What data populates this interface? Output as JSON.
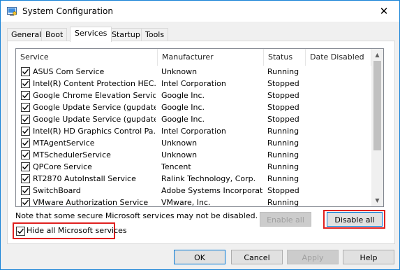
{
  "window": {
    "title": "System Configuration",
    "close_glyph": "✕"
  },
  "tabs": [
    {
      "label": "General"
    },
    {
      "label": "Boot"
    },
    {
      "label": "Services"
    },
    {
      "label": "Startup"
    },
    {
      "label": "Tools"
    }
  ],
  "services": {
    "columns": [
      "Service",
      "Manufacturer",
      "Status",
      "Date Disabled"
    ],
    "rows": [
      {
        "name": "ASUS Com Service",
        "manufacturer": "Unknown",
        "status": "Running",
        "date_disabled": "",
        "checked": true
      },
      {
        "name": "Intel(R) Content Protection HEC...",
        "manufacturer": "Intel Corporation",
        "status": "Stopped",
        "date_disabled": "",
        "checked": true
      },
      {
        "name": "Google Chrome Elevation Service",
        "manufacturer": "Google Inc.",
        "status": "Stopped",
        "date_disabled": "",
        "checked": true
      },
      {
        "name": "Google Update Service (gupdate)",
        "manufacturer": "Google Inc.",
        "status": "Stopped",
        "date_disabled": "",
        "checked": true
      },
      {
        "name": "Google Update Service (gupdatem)",
        "manufacturer": "Google Inc.",
        "status": "Stopped",
        "date_disabled": "",
        "checked": true
      },
      {
        "name": "Intel(R) HD Graphics Control Pa...",
        "manufacturer": "Intel Corporation",
        "status": "Running",
        "date_disabled": "",
        "checked": true
      },
      {
        "name": "MTAgentService",
        "manufacturer": "Unknown",
        "status": "Running",
        "date_disabled": "",
        "checked": true
      },
      {
        "name": "MTSchedulerService",
        "manufacturer": "Unknown",
        "status": "Running",
        "date_disabled": "",
        "checked": true
      },
      {
        "name": "QPCore Service",
        "manufacturer": "Tencent",
        "status": "Running",
        "date_disabled": "",
        "checked": true
      },
      {
        "name": "RT2870 AutoInstall Service",
        "manufacturer": "Ralink Technology, Corp.",
        "status": "Running",
        "date_disabled": "",
        "checked": true
      },
      {
        "name": "SwitchBoard",
        "manufacturer": "Adobe Systems Incorporated",
        "status": "Stopped",
        "date_disabled": "",
        "checked": true
      },
      {
        "name": "VMware Authorization Service",
        "manufacturer": "VMware, Inc.",
        "status": "Running",
        "date_disabled": "",
        "checked": true
      }
    ]
  },
  "note": "Note that some secure Microsoft services may not be disabled.",
  "enable_all_label": "Enable all",
  "disable_all_label": "Disable all",
  "hide_ms_label": "Hide all Microsoft services",
  "hide_ms_checked": true,
  "footer": {
    "ok": "OK",
    "cancel": "Cancel",
    "apply": "Apply",
    "help": "Help"
  },
  "colors": {
    "highlight": "#e0201f",
    "accent": "#0078d7"
  }
}
